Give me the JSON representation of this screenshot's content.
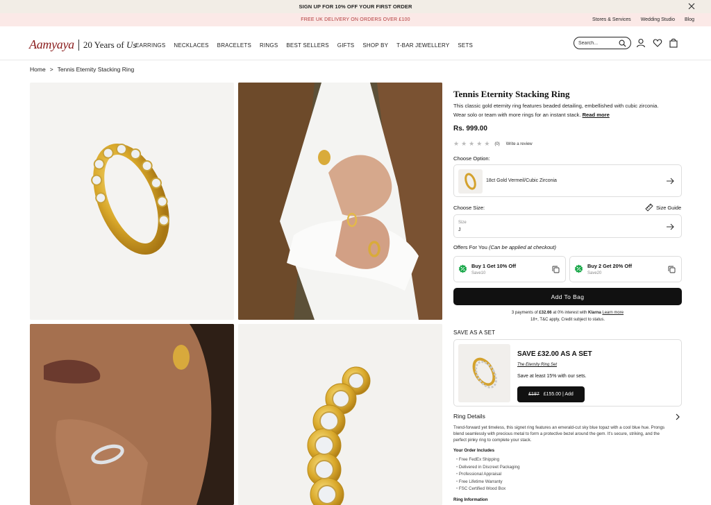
{
  "promo": {
    "top_text": "SIGN UP FOR 10% OFF YOUR FIRST ORDER",
    "second_text": "FREE UK DELIVERY ON ORDERS OVER £100",
    "links": [
      "Stores & Services",
      "Wedding Studio",
      "Blog"
    ]
  },
  "header": {
    "brand": "Aamyaya",
    "tagline_num": "20 Years of",
    "tagline_word": "Us",
    "nav": [
      "EARRINGS",
      "NECKLACES",
      "BRACELETS",
      "RINGS",
      "BEST SELLERS",
      "GIFTS",
      "SHOP BY",
      "T-BAR JEWELLERY",
      "SETS"
    ],
    "search_placeholder": "Search..."
  },
  "breadcrumb": {
    "home": "Home",
    "sep": ">",
    "current": "Tennis Eternity Stacking Ring"
  },
  "product": {
    "title": "Tennis Eternity Stacking Ring",
    "description": "This classic gold eternity ring features beaded detailing, embellished with cubic zirconia. Wear solo or team with more rings for an instant stack.",
    "read_more": "Read more",
    "price": "Rs. 999.00",
    "review_count": "(0)",
    "write_review": "Write a review",
    "choose_option_label": "Choose Option:",
    "option_value": "18ct Gold Vermeil/Cubic Zirconia",
    "choose_size_label": "Choose Size:",
    "size_guide": "Size Guide",
    "size_field_label": "Size",
    "size_value": "J",
    "offers_label": "Offers For You",
    "offers_note": "(Can be applied at checkout)",
    "offers": [
      {
        "title": "Buy 1 Get 10% Off",
        "code": "Save10"
      },
      {
        "title": "Buy 2 Get 20% Off",
        "code": "Save20"
      }
    ],
    "add_to_bag": "Add To Bag",
    "klarna_pre": "3 payments of",
    "klarna_amount": "£32.66",
    "klarna_mid": "at 0% interest with",
    "klarna_brand": "Klarna",
    "klarna_link": "Learn more",
    "klarna_line2": "18+, T&C apply, Credit subject to status."
  },
  "set": {
    "label": "SAVE AS A SET",
    "title": "SAVE £32.00 AS A SET",
    "name": "The Eternity Ring Set",
    "save_text": "Save at least 15% with our sets.",
    "old_price": "£187",
    "new_price": "£155.00 | Add"
  },
  "details": {
    "heading": "Ring Details",
    "paragraph": "Trend-forward yet timeless, this signet ring features an emerald-cut sky blue topaz with a cool blue hue. Prongs blend seamlessly with precious metal to form a protective bezel around the gem. It's secure, striking, and the perfect pinky ring to complete your stack.",
    "includes_heading": "Your Order Includes",
    "includes": [
      "Free FedEx Shipping",
      "Delivered in Discreet Packaging",
      "Professional Appraisal",
      "Free Lifetime Warranty",
      "FSC Certified Wood Box"
    ],
    "info_heading": "Ring Information"
  },
  "colors": {
    "brand": "#8a1c1c",
    "promo_text": "#b23a3a",
    "offer_badge": "#1aa84a",
    "button": "#111111"
  }
}
